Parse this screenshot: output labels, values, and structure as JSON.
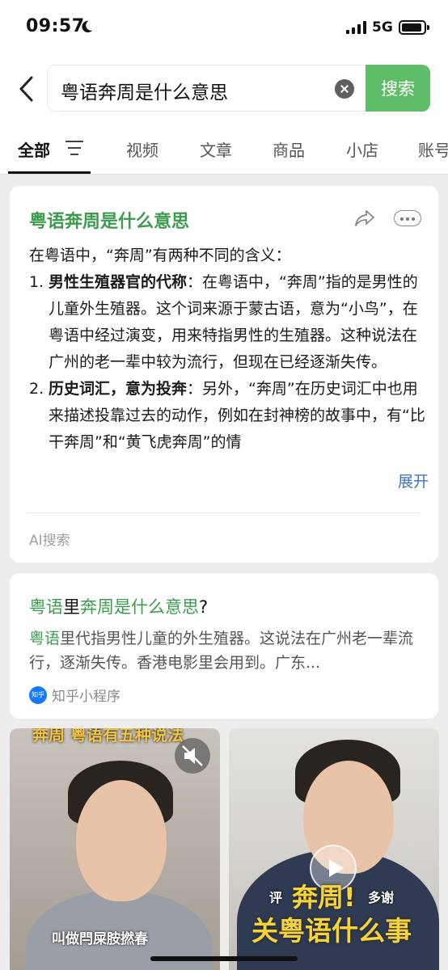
{
  "status_bar": {
    "time": "09:57",
    "network": "5G"
  },
  "search": {
    "query": "粤语奔周是什么意思",
    "button_label": "搜索"
  },
  "tabs": [
    {
      "label": "全部"
    },
    {
      "label": "视频"
    },
    {
      "label": "文章"
    },
    {
      "label": "商品"
    },
    {
      "label": "小店"
    },
    {
      "label": "账号"
    }
  ],
  "ai_answer": {
    "title": "粤语奔周是什么意思",
    "intro": "在粤语中，“奔周”有两种不同的含义：",
    "items": [
      {
        "num": "1.",
        "heading": "男性生殖器官的代称",
        "text": "：在粤语中，“奔周”指的是男性的儿童外生殖器。这个词来源于蒙古语，意为“小鸟”，在粤语中经过演变，用来特指男性的生殖器。这种说法在广州的老一辈中较为流行，但现在已经逐渐失传。"
      },
      {
        "num": "2.",
        "heading": "历史词汇，意为投奔",
        "text": "：另外，“奔周”在历史词汇中也用来描述投靠过去的动作，例如在封神榜的故事中，有“比干奔周”和“黄飞虎奔周”的情"
      }
    ],
    "expand_label": "展开",
    "source_label": "AI搜索"
  },
  "result": {
    "title_parts": [
      "粤语",
      "里",
      "奔周是什么意思",
      "?"
    ],
    "desc_hl": "粤语",
    "desc_rest": "里代指男性儿童的外生殖器。这说法在广州老一辈流行，逐渐失传。香港电影里会用到。广东...",
    "source_logo": "知乎",
    "source": "知乎小程序"
  },
  "videos": [
    {
      "banner": "奔周 粤语有五种说法",
      "caption": "叫做閂屎胺撚春"
    },
    {
      "caption_left": "评",
      "caption_right": "多谢",
      "big_line1": "奔周!",
      "big_line2": "关粤语什么事"
    }
  ]
}
